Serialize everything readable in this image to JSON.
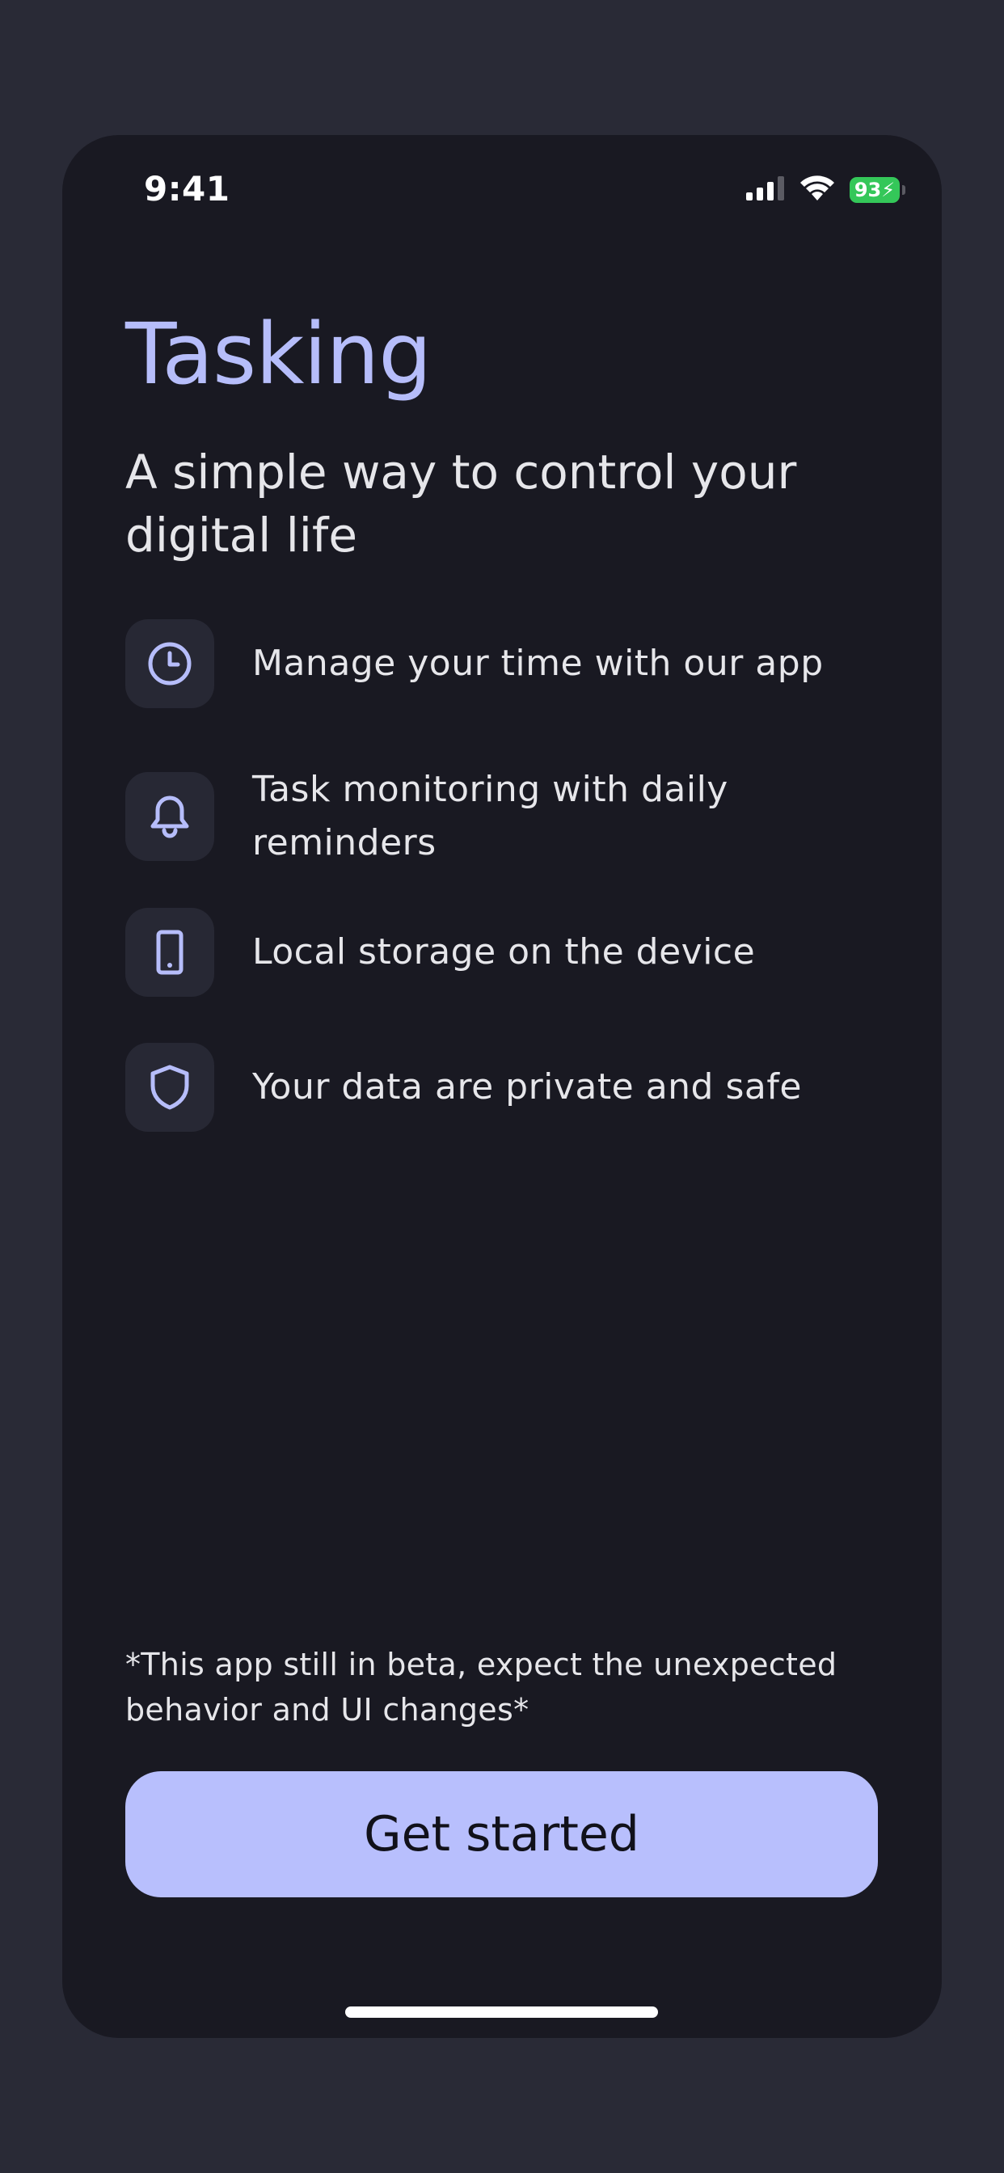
{
  "status_bar": {
    "time": "9:41",
    "battery_level": "93",
    "icons": [
      "cellular-signal-icon",
      "wifi-icon",
      "battery-charging-icon"
    ],
    "battery_color": "#34c759"
  },
  "header": {
    "title": "Tasking",
    "subtitle": "A simple way to control your digital life"
  },
  "features": [
    {
      "icon": "clock-icon",
      "text": "Manage your time with our app"
    },
    {
      "icon": "bell-icon",
      "text": "Task monitoring with daily reminders"
    },
    {
      "icon": "smartphone-icon",
      "text": "Local storage on the device"
    },
    {
      "icon": "shield-icon",
      "text": "Your data are private and safe"
    }
  ],
  "footer": {
    "beta_note": "*This app still in beta, expect the unexpected behavior and UI changes*",
    "cta_label": "Get started"
  },
  "colors": {
    "accent": "#b6bdfa",
    "button": "#b8bffd",
    "background": "#191922",
    "icon_tile": "#272834"
  }
}
